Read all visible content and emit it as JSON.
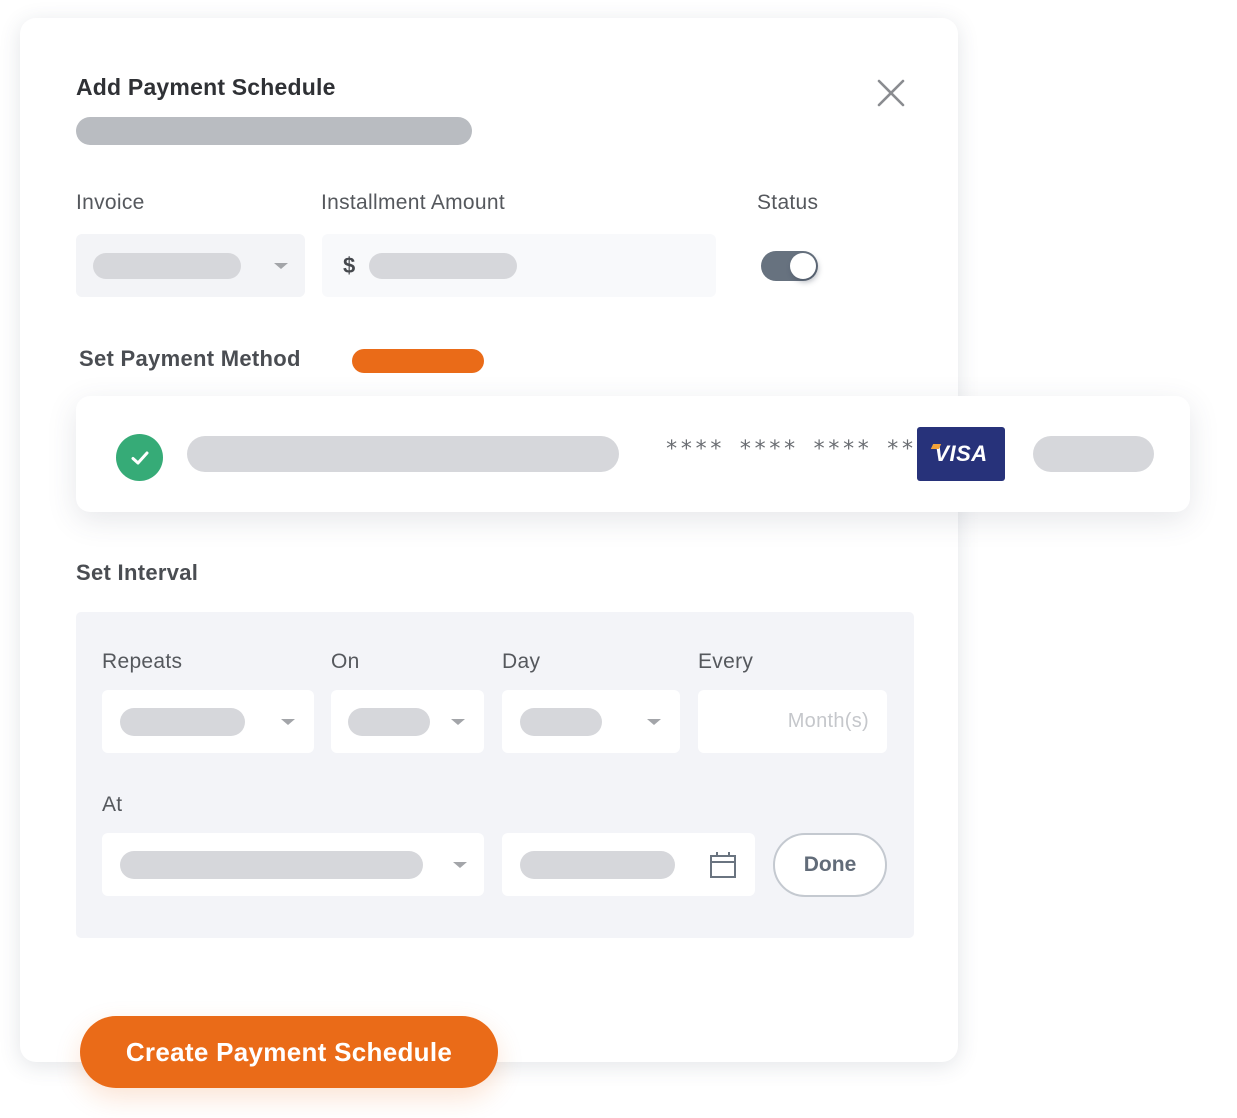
{
  "modal": {
    "title": "Add Payment Schedule",
    "close_icon": "close-icon"
  },
  "fields": {
    "invoice": {
      "label": "Invoice",
      "icon": "chevron-down-icon"
    },
    "installment_amount": {
      "label": "Installment Amount",
      "currency_symbol": "$"
    },
    "status": {
      "label": "Status",
      "toggle_on": true
    }
  },
  "payment_method": {
    "label": "Set Payment Method",
    "badge_color": "#ea6b18",
    "selected": true,
    "selected_icon": "check-circle-icon",
    "card_number": "**** **** **** ****",
    "card_brand": "VISA"
  },
  "interval": {
    "label": "Set Interval",
    "repeats": {
      "label": "Repeats"
    },
    "on": {
      "label": "On"
    },
    "day": {
      "label": "Day"
    },
    "every": {
      "label": "Every",
      "placeholder": "Month(s)"
    },
    "at": {
      "label": "At"
    },
    "date_icon": "calendar-icon",
    "done_label": "Done"
  },
  "footer": {
    "create_label": "Create Payment Schedule"
  },
  "colors": {
    "accent": "#ea6b18",
    "success": "#36ab77",
    "visa_blue": "#27327a",
    "toggle": "#67727f"
  }
}
